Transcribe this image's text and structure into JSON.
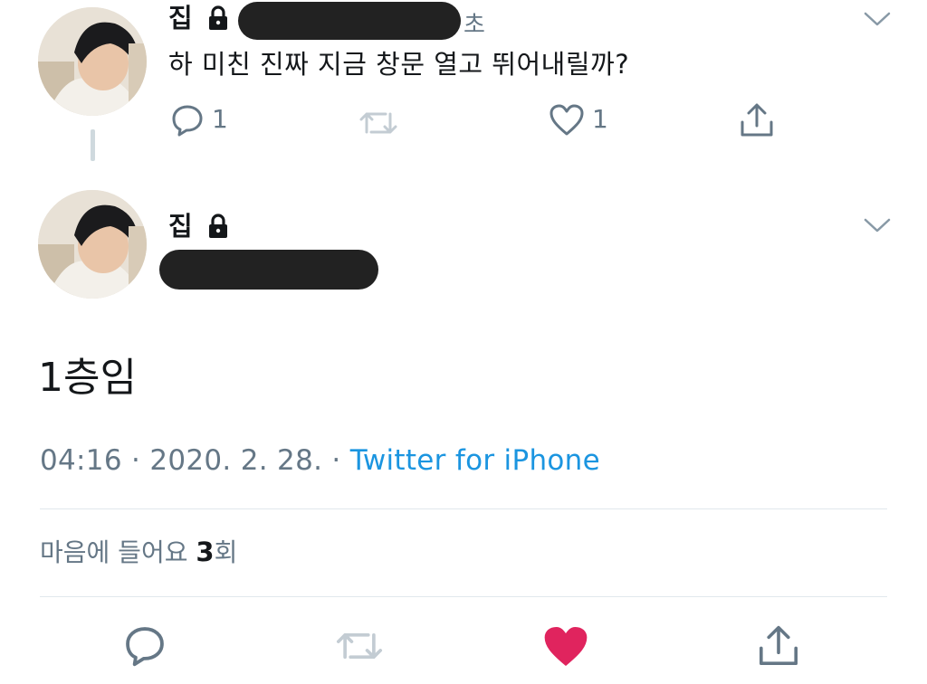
{
  "reply_tweet": {
    "author_name": "집",
    "author_locked_icon": "lock-icon",
    "time_suffix": "초",
    "text": "하 미친 진짜 지금 창문 열고 뛰어내릴까?",
    "reply_count": "1",
    "like_count": "1",
    "icons": [
      "reply-icon",
      "retweet-icon",
      "like-icon",
      "share-icon",
      "chevron-down-icon"
    ]
  },
  "main_tweet": {
    "author_name": "집",
    "author_locked_icon": "lock-icon",
    "text": "1층임",
    "time": "04:16",
    "separator1": "·",
    "date": "2020. 2. 28.",
    "separator2": "·",
    "source": "Twitter for iPhone",
    "likes_prefix": "마음에 들어요",
    "likes_count": "3",
    "likes_suffix": "회",
    "liked": true,
    "colors": {
      "like_active": "#e0245e",
      "link": "#1b95e0",
      "muted": "#657786"
    }
  }
}
